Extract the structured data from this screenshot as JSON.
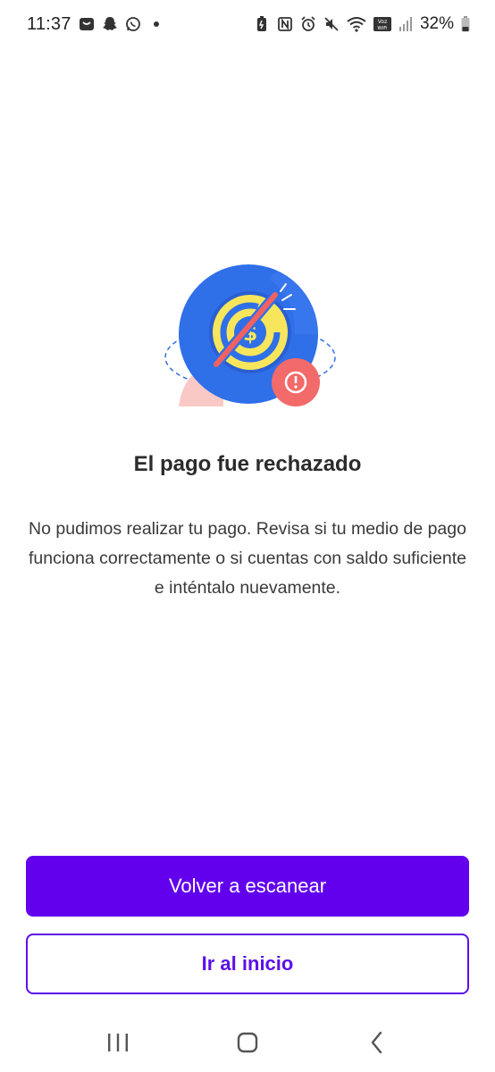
{
  "status_bar": {
    "time": "11:37",
    "battery": "32%",
    "icons_left": [
      "shopping-bag-icon",
      "snapchat-icon",
      "whatsapp-icon",
      "dot-icon"
    ],
    "icons_right": [
      "battery-saver-icon",
      "nfc-icon",
      "alarm-icon",
      "mute-icon",
      "wifi-icon",
      "vowifi-icon",
      "signal-icon",
      "battery-icon"
    ]
  },
  "illustration": {
    "icon": "payment-rejected-icon",
    "colors": {
      "circle": "#2f6fe8",
      "coin": "#f7e65c",
      "strike": "#f06262",
      "alert": "#f26a6a",
      "blob": "#f9c9c6"
    }
  },
  "message": {
    "title": "El pago fue rechazado",
    "description": "No pudimos realizar tu pago. Revisa si tu medio de pago funciona correctamente o si cuentas con saldo suficiente e inténtalo nuevamente."
  },
  "actions": {
    "primary_label": "Volver a escanear",
    "secondary_label": "Ir al inicio",
    "primary_color": "#6200ee"
  },
  "nav_bar": {
    "icons": [
      "recent-apps-icon",
      "home-icon",
      "back-icon"
    ]
  }
}
